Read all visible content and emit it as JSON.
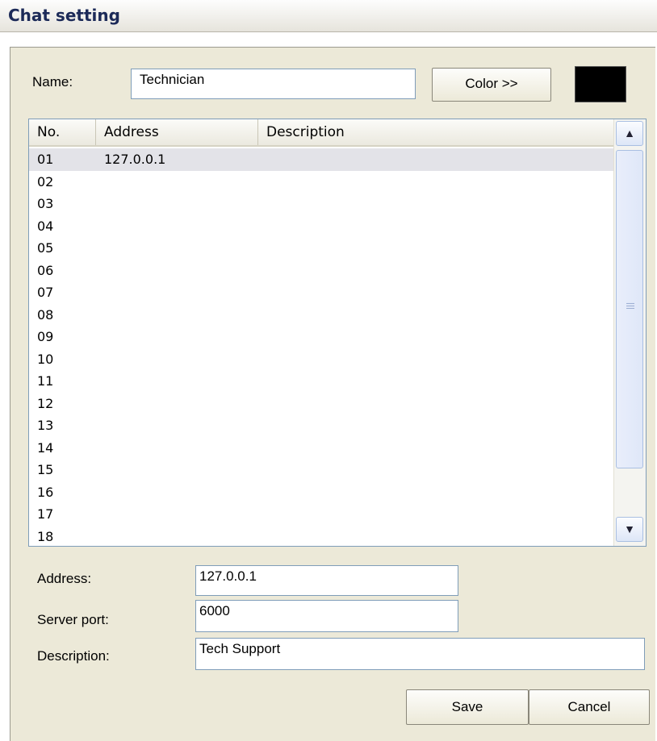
{
  "window": {
    "title": "Chat setting"
  },
  "name_row": {
    "label": "Name:",
    "value": "Technician",
    "color_button": "Color >>",
    "swatch_color": "#000000"
  },
  "list": {
    "columns": [
      "No.",
      "Address",
      "Description"
    ],
    "rows": [
      {
        "no": "01",
        "address": "127.0.0.1",
        "description": "",
        "selected": true
      },
      {
        "no": "02",
        "address": "",
        "description": ""
      },
      {
        "no": "03",
        "address": "",
        "description": ""
      },
      {
        "no": "04",
        "address": "",
        "description": ""
      },
      {
        "no": "05",
        "address": "",
        "description": ""
      },
      {
        "no": "06",
        "address": "",
        "description": ""
      },
      {
        "no": "07",
        "address": "",
        "description": ""
      },
      {
        "no": "08",
        "address": "",
        "description": ""
      },
      {
        "no": "09",
        "address": "",
        "description": ""
      },
      {
        "no": "10",
        "address": "",
        "description": ""
      },
      {
        "no": "11",
        "address": "",
        "description": ""
      },
      {
        "no": "12",
        "address": "",
        "description": ""
      },
      {
        "no": "13",
        "address": "",
        "description": ""
      },
      {
        "no": "14",
        "address": "",
        "description": ""
      },
      {
        "no": "15",
        "address": "",
        "description": ""
      },
      {
        "no": "16",
        "address": "",
        "description": ""
      },
      {
        "no": "17",
        "address": "",
        "description": ""
      },
      {
        "no": "18",
        "address": "",
        "description": ""
      }
    ]
  },
  "form": {
    "address_label": "Address:",
    "address_value": "127.0.0.1",
    "port_label": "Server port:",
    "port_value": "6000",
    "description_label": "Description:",
    "description_value": "Tech Support"
  },
  "buttons": {
    "save": "Save",
    "cancel": "Cancel"
  }
}
